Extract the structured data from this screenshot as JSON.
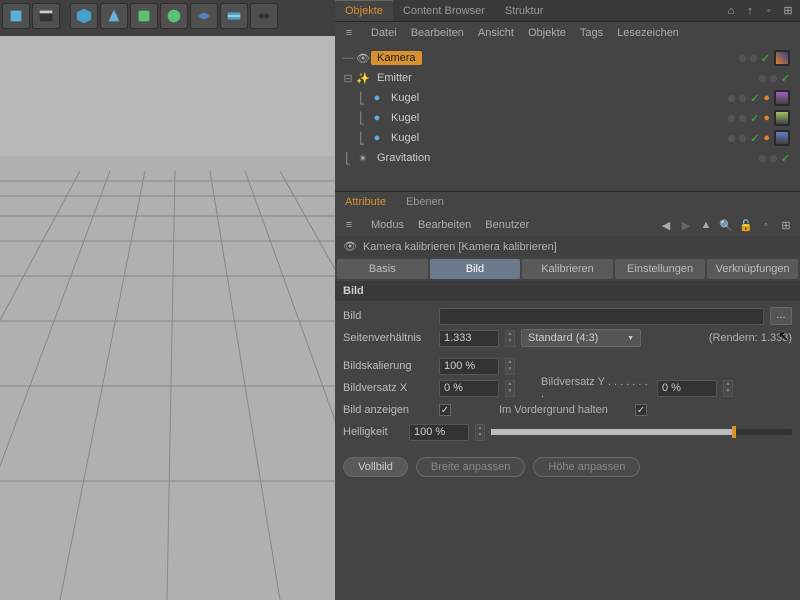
{
  "toolbar": {
    "tools": [
      "cube",
      "clapper",
      "cube2",
      "pyramid",
      "cube3",
      "gear",
      "arc",
      "grid",
      "camera"
    ]
  },
  "panels": {
    "tabs": {
      "objects": "Objekte",
      "content": "Content Browser",
      "structure": "Struktur"
    },
    "menu": {
      "file": "Datei",
      "edit": "Bearbeiten",
      "view": "Ansicht",
      "objects": "Objekte",
      "tags": "Tags",
      "bookmarks": "Lesezeichen"
    }
  },
  "hierarchy": {
    "items": [
      {
        "label": "Kamera",
        "indent": 0,
        "selected": true
      },
      {
        "label": "Emitter",
        "indent": 0
      },
      {
        "label": "Kugel",
        "indent": 1
      },
      {
        "label": "Kugel",
        "indent": 1
      },
      {
        "label": "Kugel",
        "indent": 1
      },
      {
        "label": "Gravitation",
        "indent": 0
      }
    ]
  },
  "attr": {
    "tabs": {
      "attribute": "Attribute",
      "layers": "Ebenen"
    },
    "menu": {
      "mode": "Modus",
      "edit": "Bearbeiten",
      "user": "Benutzer"
    },
    "title": "Kamera kalibrieren [Kamera kalibrieren]",
    "subtabs": {
      "basis": "Basis",
      "bild": "Bild",
      "calibrate": "Kalibrieren",
      "settings": "Einstellungen",
      "links": "Verknüpfungen"
    },
    "section": "Bild",
    "fields": {
      "bild_label": "Bild",
      "aspect_label": "Seitenverhältnis",
      "aspect_value": "1.333",
      "preset": "Standard (4:3)",
      "render": "(Rendern: 1.333)",
      "scale_label": "Bildskalierung",
      "scale_value": "100 %",
      "offsetx_label": "Bildversatz X",
      "offsetx_value": "0 %",
      "offsety_label": "Bildversatz Y",
      "offsety_value": "0 %",
      "show_label": "Bild anzeigen",
      "foreground_label": "Im Vordergrund halten",
      "brightness_label": "Helligkeit",
      "brightness_value": "100 %"
    },
    "buttons": {
      "fullscreen": "Vollbild",
      "fit_width": "Breite anpassen",
      "fit_height": "Höhe anpassen"
    }
  }
}
